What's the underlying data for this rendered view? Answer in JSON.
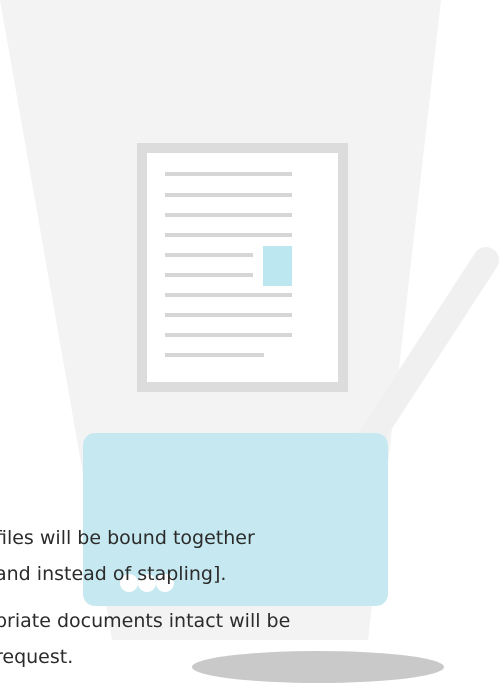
{
  "caption": {
    "line1": "files will be bound together",
    "line2": "and instead of stapling].",
    "line3": "priate documents intact will be",
    "line4": "request."
  },
  "colors": {
    "beam": "#f3f3f4",
    "document_frame": "#dcdcdc",
    "document_page": "#ffffff",
    "text_lines": "#d6d6d6",
    "highlight": "#bde7f0",
    "scanner_body": "#c6e9f1",
    "scanner_buttons": "#ffffff",
    "arm": "#f0f0f0",
    "shadow": "#c9c9c9"
  }
}
